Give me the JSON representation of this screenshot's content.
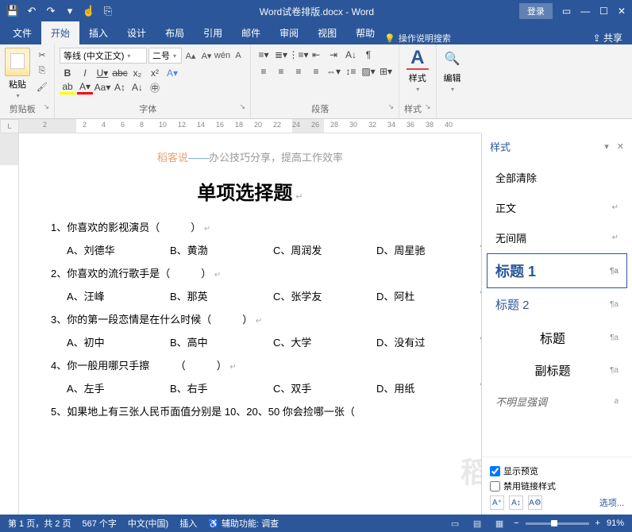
{
  "titlebar": {
    "doc_title": "Word试卷排版.docx - Word",
    "login": "登录"
  },
  "tabs": {
    "file": "文件",
    "home": "开始",
    "insert": "插入",
    "design": "设计",
    "layout": "布局",
    "references": "引用",
    "mail": "邮件",
    "review": "审阅",
    "view": "视图",
    "help": "帮助",
    "tellme": "操作说明搜索",
    "share": "共享"
  },
  "ribbon": {
    "clipboard": {
      "label": "剪贴板",
      "paste": "粘贴"
    },
    "font": {
      "label": "字体",
      "name": "等线 (中文正文)",
      "size": "二号"
    },
    "paragraph": {
      "label": "段落"
    },
    "styles": {
      "label": "样式",
      "text": "样式"
    },
    "editing": {
      "label": "编辑",
      "text": "编辑"
    }
  },
  "document": {
    "header_brand": "稻客说",
    "header_dash": "——",
    "header_slogan": "办公技巧分享，提高工作效率",
    "title": "单项选择题",
    "questions": [
      {
        "q": "1、你喜欢的影视演员（　　　）",
        "opts": [
          "A、刘德华",
          "B、黄渤",
          "C、周润发",
          "D、周星驰"
        ]
      },
      {
        "q": "2、你喜欢的流行歌手是（　　　）",
        "opts": [
          "A、汪峰",
          "B、那英",
          "C、张学友",
          "D、阿杜"
        ]
      },
      {
        "q": "3、你的第一段恋情是在什么时候（　　　）",
        "opts": [
          "A、初中",
          "B、高中",
          "C、大学",
          "D、没有过"
        ]
      },
      {
        "q": "4、你一般用哪只手擦　　　（　　　）",
        "opts": [
          "A、左手",
          "B、右手",
          "C、双手",
          "D、用纸"
        ]
      },
      {
        "q": "5、如果地上有三张人民币面值分别是 10、20、50 你会捡哪一张（",
        "opts": []
      }
    ],
    "watermark": "稻"
  },
  "styles_pane": {
    "title": "样式",
    "items": {
      "clear": "全部清除",
      "normal": "正文",
      "nospace": "无间隔",
      "h1": "标题 1",
      "h2": "标题 2",
      "title": "标题",
      "subtitle": "副标题",
      "emphasis": "不明显强调"
    },
    "show_preview": "显示预览",
    "disable_linked": "禁用链接样式",
    "options": "选项..."
  },
  "statusbar": {
    "page": "第 1 页，共 2 页",
    "words": "567 个字",
    "lang": "中文(中国)",
    "insert": "插入",
    "a11y": "辅助功能: 调查",
    "zoom": "91%"
  }
}
